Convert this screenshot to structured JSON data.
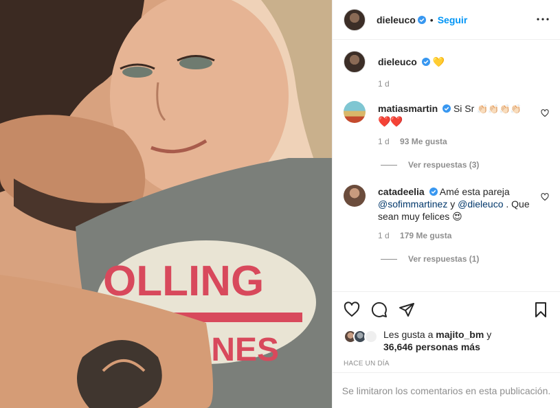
{
  "post": {
    "author": "dieleuco",
    "follow_label": "Seguir",
    "separator": "•",
    "caption_emoji": "💛",
    "caption_time": "1 d"
  },
  "comments": [
    {
      "user": "matiasmartin",
      "text_prefix": "Si Sr",
      "emoji_line1": "👏🏻👏🏻👏🏻👏🏻",
      "emoji_line2": "❤️❤️",
      "time": "1 d",
      "likes": "93 Me gusta",
      "replies": "Ver respuestas (3)"
    },
    {
      "user": "catadeelia",
      "text_1": "Amé esta pareja",
      "mention_1": "@sofimmartinez",
      "text_2": "y",
      "mention_2": "@dieleuco",
      "text_3": ". Que sean muy felices",
      "emoji": "😍",
      "time": "1 d",
      "likes": "179 Me gusta",
      "replies": "Ver respuestas (1)"
    }
  ],
  "likes": {
    "prefix": "Les gusta a",
    "user": "majito_bm",
    "conj": "y",
    "count": "36,646 personas más"
  },
  "posted_ago": "HACE UN DÍA",
  "comments_limited": "Se limitaron los comentarios en esta publicación.",
  "colors": {
    "accent": "#0095f6",
    "verified": "#3897f0",
    "muted": "#8e8e8e",
    "link": "#00376b"
  },
  "icons": [
    "more-icon",
    "verified-icon",
    "heart-icon",
    "comment-icon",
    "share-icon",
    "bookmark-icon"
  ]
}
